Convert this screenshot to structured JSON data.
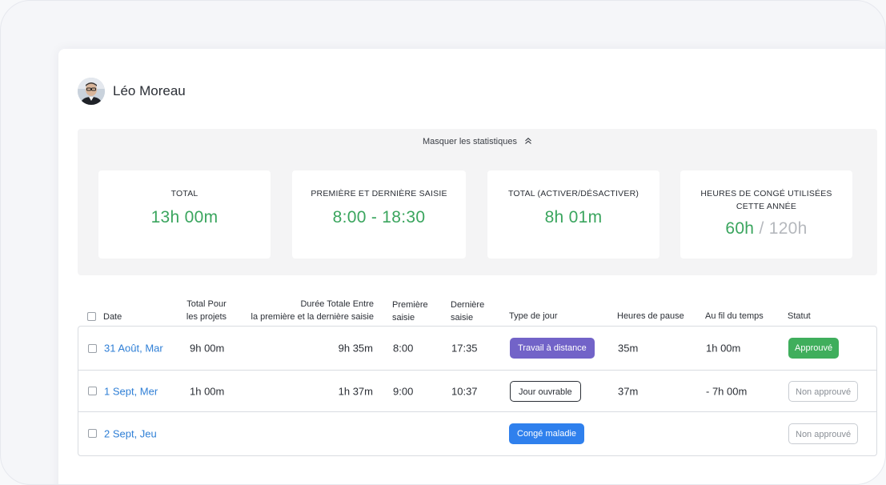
{
  "user": {
    "name": "Léo Moreau"
  },
  "stats": {
    "toggle_label": "Masquer les statistiques",
    "cards": [
      {
        "label": "TOTAL",
        "value": "13h 00m"
      },
      {
        "label": "PREMIÈRE ET DERNIÈRE SAISIE",
        "value": "8:00 - 18:30"
      },
      {
        "label": "TOTAL (ACTIVER/DÉSACTIVER)",
        "value": "8h 01m"
      },
      {
        "label": "HEURES DE CONGÉ UTILISÉES CETTE ANNÉE",
        "used": "60h",
        "separator": "/",
        "limit": "120h"
      }
    ]
  },
  "table": {
    "headers": {
      "date": "Date",
      "total_projects_1": "Total Pour",
      "total_projects_2": "les projets",
      "duration_1": "Durée Totale Entre",
      "duration_2": "la première et la dernière saisie",
      "first_1": "Première",
      "first_2": "saisie",
      "last_1": "Dernière",
      "last_2": "saisie",
      "day_type": "Type de jour",
      "break": "Heures de pause",
      "timeline": "Au fil du temps",
      "status": "Statut"
    },
    "rows": [
      {
        "date": "31 Août, Mar",
        "total": "9h 00m",
        "duration": "9h 35m",
        "first": "8:00",
        "last": "17:35",
        "day_type": "Travail à distance",
        "break": "35m",
        "timeline": "1h 00m",
        "status": "Approuvé"
      },
      {
        "date": "1 Sept, Mer",
        "total": "1h 00m",
        "duration": "1h 37m",
        "first": "9:00",
        "last": "10:37",
        "day_type": "Jour ouvrable",
        "break": "37m",
        "timeline": "- 7h 00m",
        "status": "Non approuvé"
      },
      {
        "date": "2 Sept, Jeu",
        "total": "",
        "duration": "",
        "first": "",
        "last": "",
        "day_type": "Congé maladie",
        "break": "",
        "timeline": "",
        "status": "Non approuvé"
      }
    ]
  },
  "colors": {
    "accent_green": "#3aa55e",
    "link_blue": "#2f7fd6",
    "remote_purple": "#7263c8",
    "sick_blue": "#2f80ed",
    "approved_green": "#3fae5c"
  },
  "icons": {
    "toggle": "chevron-double-up-icon",
    "checkbox": "checkbox-icon"
  }
}
